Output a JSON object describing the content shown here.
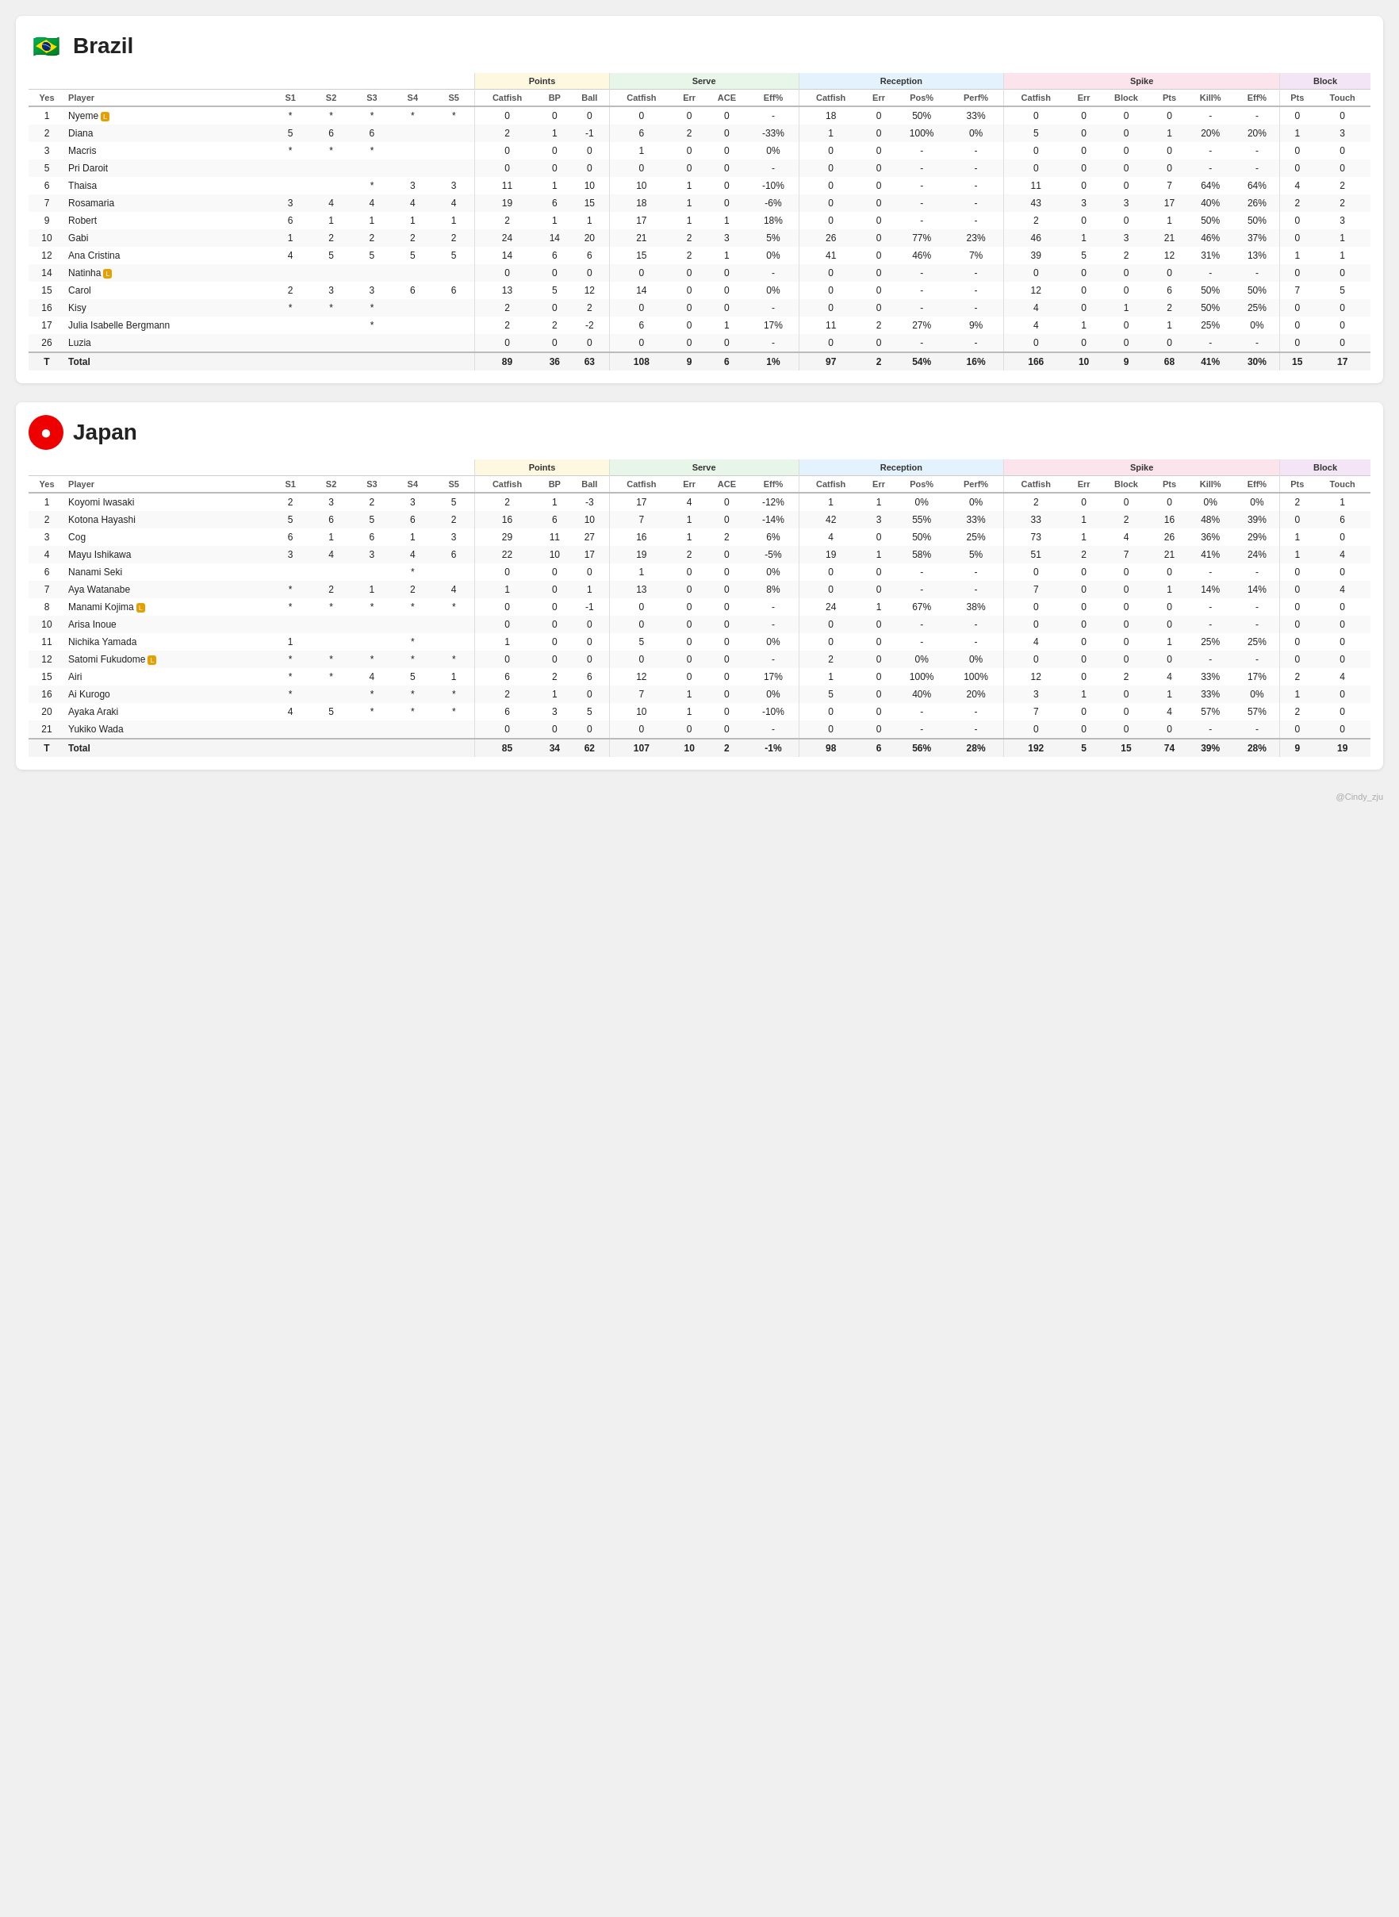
{
  "brazil": {
    "team": "Brazil",
    "flag": "🇧🇷",
    "columns": {
      "yes": "Yes",
      "player": "Player",
      "s1": "S1",
      "s2": "S2",
      "s3": "S3",
      "s4": "S4",
      "s5": "S5",
      "points_catfish": "Catfish",
      "points_bp": "BP",
      "points_ball": "Ball",
      "serve_catfish": "Catfish",
      "serve_err": "Err",
      "serve_ace": "ACE",
      "serve_eff": "Eff%",
      "rec_catfish": "Catfish",
      "rec_err": "Err",
      "rec_pos": "Pos%",
      "rec_perf": "Perf%",
      "spike_catfish": "Catfish",
      "spike_err": "Err",
      "spike_block": "Block",
      "spike_pts": "Pts",
      "spike_kill": "Kill%",
      "spike_eff": "Eff%",
      "block_pts": "Pts",
      "block_touch": "Touch"
    },
    "players": [
      {
        "no": "1",
        "name": "Nyeme",
        "libero": true,
        "s1": "*",
        "s2": "*",
        "s3": "*",
        "s4": "*",
        "s5": "*",
        "pc": "0",
        "bp": "0",
        "ball": "0",
        "sc": "0",
        "se": "0",
        "ace": "0",
        "seff": "-",
        "rc": "18",
        "re": "0",
        "pos": "50%",
        "perf": "33%",
        "spkc": "0",
        "spke": "0",
        "blk": "0",
        "spts": "0",
        "kill": "-",
        "spkeff": "-",
        "bpts": "0",
        "btouch": "0"
      },
      {
        "no": "2",
        "name": "Diana",
        "libero": false,
        "s1": "5",
        "s2": "6",
        "s3": "6",
        "s4": "",
        "s5": "",
        "pc": "2",
        "bp": "1",
        "ball": "-1",
        "sc": "6",
        "se": "2",
        "ace": "0",
        "seff": "-33%",
        "rc": "1",
        "re": "0",
        "pos": "100%",
        "perf": "0%",
        "spkc": "5",
        "spke": "0",
        "blk": "0",
        "spts": "1",
        "kill": "20%",
        "spkeff": "20%",
        "bpts": "1",
        "btouch": "3"
      },
      {
        "no": "3",
        "name": "Macris",
        "libero": false,
        "s1": "*",
        "s2": "*",
        "s3": "*",
        "s4": "",
        "s5": "",
        "pc": "0",
        "bp": "0",
        "ball": "0",
        "sc": "1",
        "se": "0",
        "ace": "0",
        "seff": "0%",
        "rc": "0",
        "re": "0",
        "pos": "-",
        "perf": "-",
        "spkc": "0",
        "spke": "0",
        "blk": "0",
        "spts": "0",
        "kill": "-",
        "spkeff": "-",
        "bpts": "0",
        "btouch": "0"
      },
      {
        "no": "5",
        "name": "Pri Daroit",
        "libero": false,
        "s1": "",
        "s2": "",
        "s3": "",
        "s4": "",
        "s5": "",
        "pc": "0",
        "bp": "0",
        "ball": "0",
        "sc": "0",
        "se": "0",
        "ace": "0",
        "seff": "-",
        "rc": "0",
        "re": "0",
        "pos": "-",
        "perf": "-",
        "spkc": "0",
        "spke": "0",
        "blk": "0",
        "spts": "0",
        "kill": "-",
        "spkeff": "-",
        "bpts": "0",
        "btouch": "0"
      },
      {
        "no": "6",
        "name": "Thaisa",
        "libero": false,
        "s1": "",
        "s2": "",
        "s3": "*",
        "s4": "3",
        "s5": "3",
        "pc": "11",
        "bp": "1",
        "ball": "10",
        "sc": "10",
        "se": "1",
        "ace": "0",
        "seff": "-10%",
        "rc": "0",
        "re": "0",
        "pos": "-",
        "perf": "-",
        "spkc": "11",
        "spke": "0",
        "blk": "0",
        "spts": "7",
        "kill": "64%",
        "spkeff": "64%",
        "bpts": "4",
        "btouch": "2"
      },
      {
        "no": "7",
        "name": "Rosamaria",
        "libero": false,
        "s1": "3",
        "s2": "4",
        "s3": "4",
        "s4": "4",
        "s5": "4",
        "pc": "19",
        "bp": "6",
        "ball": "15",
        "sc": "18",
        "se": "1",
        "ace": "0",
        "seff": "-6%",
        "rc": "0",
        "re": "0",
        "pos": "-",
        "perf": "-",
        "spkc": "43",
        "spke": "3",
        "blk": "3",
        "spts": "17",
        "kill": "40%",
        "spkeff": "26%",
        "bpts": "2",
        "btouch": "2"
      },
      {
        "no": "9",
        "name": "Robert",
        "libero": false,
        "s1": "6",
        "s2": "1",
        "s3": "1",
        "s4": "1",
        "s5": "1",
        "pc": "2",
        "bp": "1",
        "ball": "1",
        "sc": "17",
        "se": "1",
        "ace": "1",
        "seff": "18%",
        "rc": "0",
        "re": "0",
        "pos": "-",
        "perf": "-",
        "spkc": "2",
        "spke": "0",
        "blk": "0",
        "spts": "1",
        "kill": "50%",
        "spkeff": "50%",
        "bpts": "0",
        "btouch": "3"
      },
      {
        "no": "10",
        "name": "Gabi",
        "libero": false,
        "s1": "1",
        "s2": "2",
        "s3": "2",
        "s4": "2",
        "s5": "2",
        "pc": "24",
        "bp": "14",
        "ball": "20",
        "sc": "21",
        "se": "2",
        "ace": "3",
        "seff": "5%",
        "rc": "26",
        "re": "0",
        "pos": "77%",
        "perf": "23%",
        "spkc": "46",
        "spke": "1",
        "blk": "3",
        "spts": "21",
        "kill": "46%",
        "spkeff": "37%",
        "bpts": "0",
        "btouch": "1"
      },
      {
        "no": "12",
        "name": "Ana Cristina",
        "libero": false,
        "s1": "4",
        "s2": "5",
        "s3": "5",
        "s4": "5",
        "s5": "5",
        "pc": "14",
        "bp": "6",
        "ball": "6",
        "sc": "15",
        "se": "2",
        "ace": "1",
        "seff": "0%",
        "rc": "41",
        "re": "0",
        "pos": "46%",
        "perf": "7%",
        "spkc": "39",
        "spke": "5",
        "blk": "2",
        "spts": "12",
        "kill": "31%",
        "spkeff": "13%",
        "bpts": "1",
        "btouch": "1"
      },
      {
        "no": "14",
        "name": "Natinha",
        "libero": true,
        "s1": "",
        "s2": "",
        "s3": "",
        "s4": "",
        "s5": "",
        "pc": "0",
        "bp": "0",
        "ball": "0",
        "sc": "0",
        "se": "0",
        "ace": "0",
        "seff": "-",
        "rc": "0",
        "re": "0",
        "pos": "-",
        "perf": "-",
        "spkc": "0",
        "spke": "0",
        "blk": "0",
        "spts": "0",
        "kill": "-",
        "spkeff": "-",
        "bpts": "0",
        "btouch": "0"
      },
      {
        "no": "15",
        "name": "Carol",
        "libero": false,
        "s1": "2",
        "s2": "3",
        "s3": "3",
        "s4": "6",
        "s5": "6",
        "pc": "13",
        "bp": "5",
        "ball": "12",
        "sc": "14",
        "se": "0",
        "ace": "0",
        "seff": "0%",
        "rc": "0",
        "re": "0",
        "pos": "-",
        "perf": "-",
        "spkc": "12",
        "spke": "0",
        "blk": "0",
        "spts": "6",
        "kill": "50%",
        "spkeff": "50%",
        "bpts": "7",
        "btouch": "5"
      },
      {
        "no": "16",
        "name": "Kisy",
        "libero": false,
        "s1": "*",
        "s2": "*",
        "s3": "*",
        "s4": "",
        "s5": "",
        "pc": "2",
        "bp": "0",
        "ball": "2",
        "sc": "0",
        "se": "0",
        "ace": "0",
        "seff": "-",
        "rc": "0",
        "re": "0",
        "pos": "-",
        "perf": "-",
        "spkc": "4",
        "spke": "0",
        "blk": "1",
        "spts": "2",
        "kill": "50%",
        "spkeff": "25%",
        "bpts": "0",
        "btouch": "0"
      },
      {
        "no": "17",
        "name": "Julia Isabelle Bergmann",
        "libero": false,
        "s1": "",
        "s2": "",
        "s3": "*",
        "s4": "",
        "s5": "",
        "pc": "2",
        "bp": "2",
        "ball": "-2",
        "sc": "6",
        "se": "0",
        "ace": "1",
        "seff": "17%",
        "rc": "11",
        "re": "2",
        "pos": "27%",
        "perf": "9%",
        "spkc": "4",
        "spke": "1",
        "blk": "0",
        "spts": "1",
        "kill": "25%",
        "spkeff": "0%",
        "bpts": "0",
        "btouch": "0"
      },
      {
        "no": "26",
        "name": "Luzia",
        "libero": false,
        "s1": "",
        "s2": "",
        "s3": "",
        "s4": "",
        "s5": "",
        "pc": "0",
        "bp": "0",
        "ball": "0",
        "sc": "0",
        "se": "0",
        "ace": "0",
        "seff": "-",
        "rc": "0",
        "re": "0",
        "pos": "-",
        "perf": "-",
        "spkc": "0",
        "spke": "0",
        "blk": "0",
        "spts": "0",
        "kill": "-",
        "spkeff": "-",
        "bpts": "0",
        "btouch": "0"
      },
      {
        "no": "T",
        "name": "Total",
        "libero": false,
        "s1": "",
        "s2": "",
        "s3": "",
        "s4": "",
        "s5": "",
        "pc": "89",
        "bp": "36",
        "ball": "63",
        "sc": "108",
        "se": "9",
        "ace": "6",
        "seff": "1%",
        "rc": "97",
        "re": "2",
        "pos": "54%",
        "perf": "16%",
        "spkc": "166",
        "spke": "10",
        "blk": "9",
        "spts": "68",
        "kill": "41%",
        "spkeff": "30%",
        "bpts": "15",
        "btouch": "17",
        "isTotal": true
      }
    ]
  },
  "japan": {
    "team": "Japan",
    "flag": "🔴",
    "players": [
      {
        "no": "1",
        "name": "Koyomi Iwasaki",
        "libero": false,
        "s1": "2",
        "s2": "3",
        "s3": "2",
        "s4": "3",
        "s5": "5",
        "pc": "2",
        "bp": "1",
        "ball": "-3",
        "sc": "17",
        "se": "4",
        "ace": "0",
        "seff": "-12%",
        "rc": "1",
        "re": "1",
        "pos": "0%",
        "perf": "0%",
        "spkc": "2",
        "spke": "0",
        "blk": "0",
        "spts": "0",
        "kill": "0%",
        "spkeff": "0%",
        "bpts": "2",
        "btouch": "1"
      },
      {
        "no": "2",
        "name": "Kotona Hayashi",
        "libero": false,
        "s1": "5",
        "s2": "6",
        "s3": "5",
        "s4": "6",
        "s5": "2",
        "pc": "16",
        "bp": "6",
        "ball": "10",
        "sc": "7",
        "se": "1",
        "ace": "0",
        "seff": "-14%",
        "rc": "42",
        "re": "3",
        "pos": "55%",
        "perf": "33%",
        "spkc": "33",
        "spke": "1",
        "blk": "2",
        "spts": "16",
        "kill": "48%",
        "spkeff": "39%",
        "bpts": "0",
        "btouch": "6"
      },
      {
        "no": "3",
        "name": "Cog",
        "libero": false,
        "s1": "6",
        "s2": "1",
        "s3": "6",
        "s4": "1",
        "s5": "3",
        "pc": "29",
        "bp": "11",
        "ball": "27",
        "sc": "16",
        "se": "1",
        "ace": "2",
        "seff": "6%",
        "rc": "4",
        "re": "0",
        "pos": "50%",
        "perf": "25%",
        "spkc": "73",
        "spke": "1",
        "blk": "4",
        "spts": "26",
        "kill": "36%",
        "spkeff": "29%",
        "bpts": "1",
        "btouch": "0"
      },
      {
        "no": "4",
        "name": "Mayu Ishikawa",
        "libero": false,
        "s1": "3",
        "s2": "4",
        "s3": "3",
        "s4": "4",
        "s5": "6",
        "pc": "22",
        "bp": "10",
        "ball": "17",
        "sc": "19",
        "se": "2",
        "ace": "0",
        "seff": "-5%",
        "rc": "19",
        "re": "1",
        "pos": "58%",
        "perf": "5%",
        "spkc": "51",
        "spke": "2",
        "blk": "7",
        "spts": "21",
        "kill": "41%",
        "spkeff": "24%",
        "bpts": "1",
        "btouch": "4"
      },
      {
        "no": "6",
        "name": "Nanami Seki",
        "libero": false,
        "s1": "",
        "s2": "",
        "s3": "",
        "s4": "*",
        "s5": "",
        "pc": "0",
        "bp": "0",
        "ball": "0",
        "sc": "1",
        "se": "0",
        "ace": "0",
        "seff": "0%",
        "rc": "0",
        "re": "0",
        "pos": "-",
        "perf": "-",
        "spkc": "0",
        "spke": "0",
        "blk": "0",
        "spts": "0",
        "kill": "-",
        "spkeff": "-",
        "bpts": "0",
        "btouch": "0"
      },
      {
        "no": "7",
        "name": "Aya Watanabe",
        "libero": false,
        "s1": "*",
        "s2": "2",
        "s3": "1",
        "s4": "2",
        "s5": "4",
        "pc": "1",
        "bp": "0",
        "ball": "1",
        "sc": "13",
        "se": "0",
        "ace": "0",
        "seff": "8%",
        "rc": "0",
        "re": "0",
        "pos": "-",
        "perf": "-",
        "spkc": "7",
        "spke": "0",
        "blk": "0",
        "spts": "1",
        "kill": "14%",
        "spkeff": "14%",
        "bpts": "0",
        "btouch": "4"
      },
      {
        "no": "8",
        "name": "Manami Kojima",
        "libero": true,
        "s1": "*",
        "s2": "*",
        "s3": "*",
        "s4": "*",
        "s5": "*",
        "pc": "0",
        "bp": "0",
        "ball": "-1",
        "sc": "0",
        "se": "0",
        "ace": "0",
        "seff": "-",
        "rc": "24",
        "re": "1",
        "pos": "67%",
        "perf": "38%",
        "spkc": "0",
        "spke": "0",
        "blk": "0",
        "spts": "0",
        "kill": "-",
        "spkeff": "-",
        "bpts": "0",
        "btouch": "0"
      },
      {
        "no": "10",
        "name": "Arisa Inoue",
        "libero": false,
        "s1": "",
        "s2": "",
        "s3": "",
        "s4": "",
        "s5": "",
        "pc": "0",
        "bp": "0",
        "ball": "0",
        "sc": "0",
        "se": "0",
        "ace": "0",
        "seff": "-",
        "rc": "0",
        "re": "0",
        "pos": "-",
        "perf": "-",
        "spkc": "0",
        "spke": "0",
        "blk": "0",
        "spts": "0",
        "kill": "-",
        "spkeff": "-",
        "bpts": "0",
        "btouch": "0"
      },
      {
        "no": "11",
        "name": "Nichika Yamada",
        "libero": false,
        "s1": "1",
        "s2": "",
        "s3": "",
        "s4": "*",
        "s5": "",
        "pc": "1",
        "bp": "0",
        "ball": "0",
        "sc": "5",
        "se": "0",
        "ace": "0",
        "seff": "0%",
        "rc": "0",
        "re": "0",
        "pos": "-",
        "perf": "-",
        "spkc": "4",
        "spke": "0",
        "blk": "0",
        "spts": "1",
        "kill": "25%",
        "spkeff": "25%",
        "bpts": "0",
        "btouch": "0"
      },
      {
        "no": "12",
        "name": "Satomi Fukudome",
        "libero": true,
        "s1": "*",
        "s2": "*",
        "s3": "*",
        "s4": "*",
        "s5": "*",
        "pc": "0",
        "bp": "0",
        "ball": "0",
        "sc": "0",
        "se": "0",
        "ace": "0",
        "seff": "-",
        "rc": "2",
        "re": "0",
        "pos": "0%",
        "perf": "0%",
        "spkc": "0",
        "spke": "0",
        "blk": "0",
        "spts": "0",
        "kill": "-",
        "spkeff": "-",
        "bpts": "0",
        "btouch": "0"
      },
      {
        "no": "15",
        "name": "Airi",
        "libero": false,
        "s1": "*",
        "s2": "*",
        "s3": "4",
        "s4": "5",
        "s5": "1",
        "pc": "6",
        "bp": "2",
        "ball": "6",
        "sc": "12",
        "se": "0",
        "ace": "0",
        "seff": "17%",
        "rc": "1",
        "re": "0",
        "pos": "100%",
        "perf": "100%",
        "spkc": "12",
        "spke": "0",
        "blk": "2",
        "spts": "4",
        "kill": "33%",
        "spkeff": "17%",
        "bpts": "2",
        "btouch": "4"
      },
      {
        "no": "16",
        "name": "Ai Kurogo",
        "libero": false,
        "s1": "*",
        "s2": "",
        "s3": "*",
        "s4": "*",
        "s5": "*",
        "pc": "2",
        "bp": "1",
        "ball": "0",
        "sc": "7",
        "se": "1",
        "ace": "0",
        "seff": "0%",
        "rc": "5",
        "re": "0",
        "pos": "40%",
        "perf": "20%",
        "spkc": "3",
        "spke": "1",
        "blk": "0",
        "spts": "1",
        "kill": "33%",
        "spkeff": "0%",
        "bpts": "1",
        "btouch": "0"
      },
      {
        "no": "20",
        "name": "Ayaka Araki",
        "libero": false,
        "s1": "4",
        "s2": "5",
        "s3": "*",
        "s4": "*",
        "s5": "*",
        "pc": "6",
        "bp": "3",
        "ball": "5",
        "sc": "10",
        "se": "1",
        "ace": "0",
        "seff": "-10%",
        "rc": "0",
        "re": "0",
        "pos": "-",
        "perf": "-",
        "spkc": "7",
        "spke": "0",
        "blk": "0",
        "spts": "4",
        "kill": "57%",
        "spkeff": "57%",
        "bpts": "2",
        "btouch": "0"
      },
      {
        "no": "21",
        "name": "Yukiko Wada",
        "libero": false,
        "s1": "",
        "s2": "",
        "s3": "",
        "s4": "",
        "s5": "",
        "pc": "0",
        "bp": "0",
        "ball": "0",
        "sc": "0",
        "se": "0",
        "ace": "0",
        "seff": "-",
        "rc": "0",
        "re": "0",
        "pos": "-",
        "perf": "-",
        "spkc": "0",
        "spke": "0",
        "blk": "0",
        "spts": "0",
        "kill": "-",
        "spkeff": "-",
        "bpts": "0",
        "btouch": "0"
      },
      {
        "no": "T",
        "name": "Total",
        "libero": false,
        "s1": "",
        "s2": "",
        "s3": "",
        "s4": "",
        "s5": "",
        "pc": "85",
        "bp": "34",
        "ball": "62",
        "sc": "107",
        "se": "10",
        "ace": "2",
        "seff": "-1%",
        "rc": "98",
        "re": "6",
        "pos": "56%",
        "perf": "28%",
        "spkc": "192",
        "spke": "5",
        "blk": "15",
        "spts": "74",
        "kill": "39%",
        "spkeff": "28%",
        "bpts": "9",
        "btouch": "19",
        "isTotal": true
      }
    ]
  },
  "watermark": "@Cindy_zju"
}
